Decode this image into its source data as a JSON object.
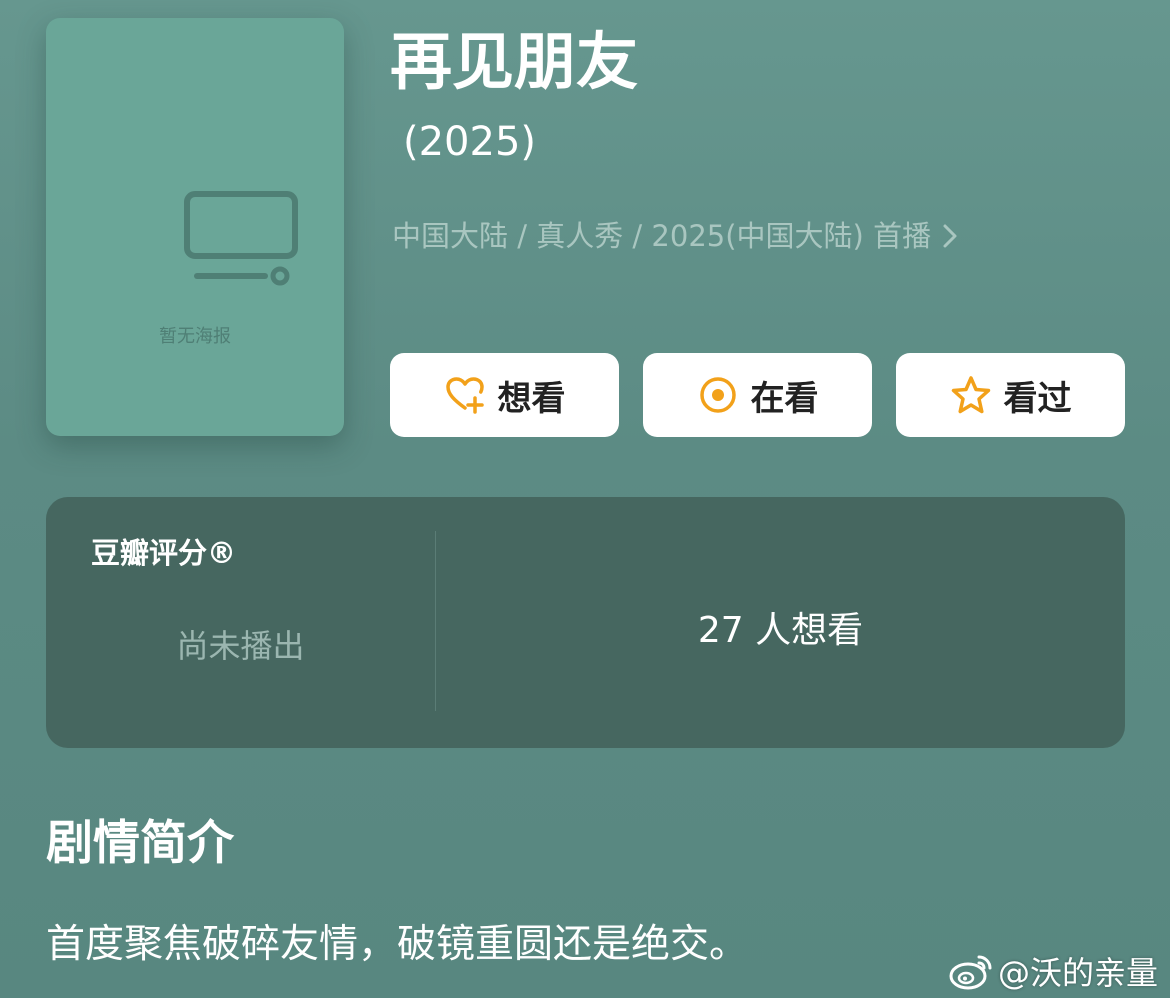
{
  "poster": {
    "placeholder_label": "暂无海报",
    "icon": "tv-icon"
  },
  "header": {
    "title": "再见朋友",
    "year": "(2025)",
    "meta": "中国大陆 / 真人秀 / 2025(中国大陆) 首播",
    "meta_icon": "chevron-right-icon"
  },
  "actions": [
    {
      "label": "想看",
      "icon": "heart-plus-icon"
    },
    {
      "label": "在看",
      "icon": "target-circle-icon"
    },
    {
      "label": "看过",
      "icon": "star-icon"
    }
  ],
  "rating": {
    "title": "豆瓣评分®",
    "status": "尚未播出",
    "want_count": "27 人想看"
  },
  "synopsis": {
    "heading": "剧情简介",
    "text": "首度聚焦破碎友情，破镜重圆还是绝交。"
  },
  "watermark": {
    "text": "@沃的亲量",
    "icon": "weibo-icon"
  },
  "colors": {
    "background": "#5f8f88",
    "poster": "#6aa698",
    "panel": "#466760",
    "accent_icon": "#f2a11a",
    "button_bg": "#ffffff",
    "meta_text": "#a9c6c0"
  }
}
